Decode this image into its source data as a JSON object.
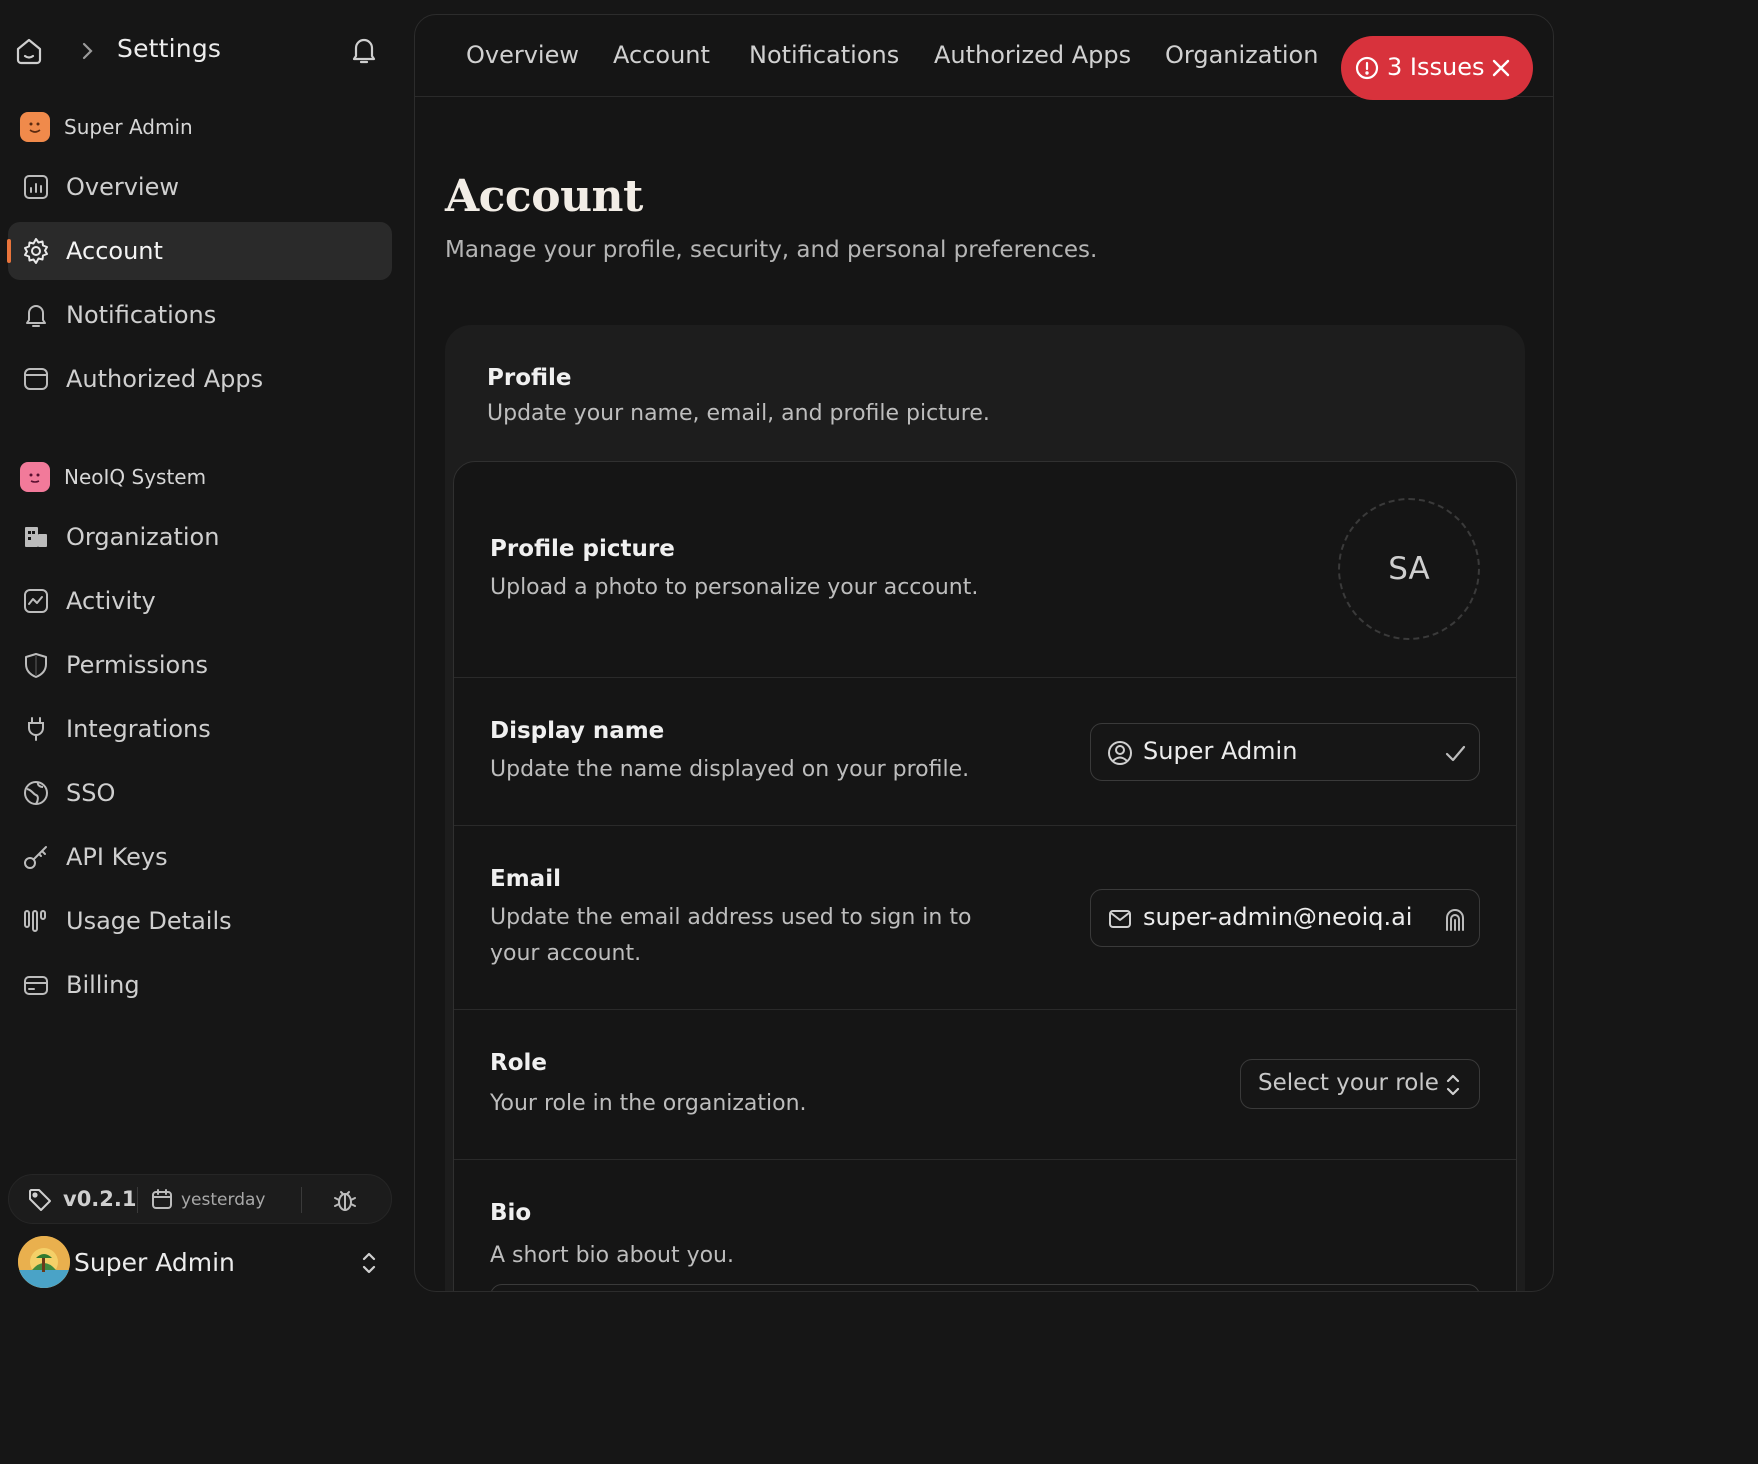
{
  "sidebar": {
    "header_title": "Settings",
    "user_section_label": "Super Admin",
    "user_items": [
      {
        "label": "Overview",
        "icon": "chart-icon"
      },
      {
        "label": "Account",
        "icon": "gear-icon",
        "active": true
      },
      {
        "label": "Notifications",
        "icon": "bell-icon"
      },
      {
        "label": "Authorized Apps",
        "icon": "app-window-icon"
      }
    ],
    "org_section_label": "NeoIQ System",
    "org_items": [
      {
        "label": "Organization",
        "icon": "building-icon"
      },
      {
        "label": "Activity",
        "icon": "activity-icon"
      },
      {
        "label": "Permissions",
        "icon": "shield-icon"
      },
      {
        "label": "Integrations",
        "icon": "plug-icon"
      },
      {
        "label": "SSO",
        "icon": "globe-icon"
      },
      {
        "label": "API Keys",
        "icon": "key-icon"
      },
      {
        "label": "Usage Details",
        "icon": "usage-icon"
      },
      {
        "label": "Billing",
        "icon": "credit-card-icon"
      }
    ],
    "footer": {
      "version": "v0.2.1",
      "date": "yesterday"
    },
    "current_user": "Super Admin",
    "accent_color": "#e8743b"
  },
  "tabs": [
    "Overview",
    "Account",
    "Notifications",
    "Authorized Apps",
    "Organization"
  ],
  "issues": {
    "label": "3 Issues",
    "color": "#d8323c"
  },
  "page": {
    "title": "Account",
    "subtitle": "Manage your profile, security, and personal preferences."
  },
  "profile": {
    "heading": "Profile",
    "subheading": "Update your name, email, and profile picture.",
    "picture": {
      "label": "Profile picture",
      "desc": "Upload a photo to personalize your account.",
      "initials": "SA"
    },
    "display_name": {
      "label": "Display name",
      "desc": "Update the name displayed on your profile.",
      "value": "Super Admin"
    },
    "email": {
      "label": "Email",
      "desc": "Update the email address used to sign in to your account.",
      "value": "super-admin@neoiq.ai"
    },
    "role": {
      "label": "Role",
      "desc": "Your role in the organization.",
      "placeholder": "Select your role"
    },
    "bio": {
      "label": "Bio",
      "desc": "A short bio about you."
    }
  }
}
